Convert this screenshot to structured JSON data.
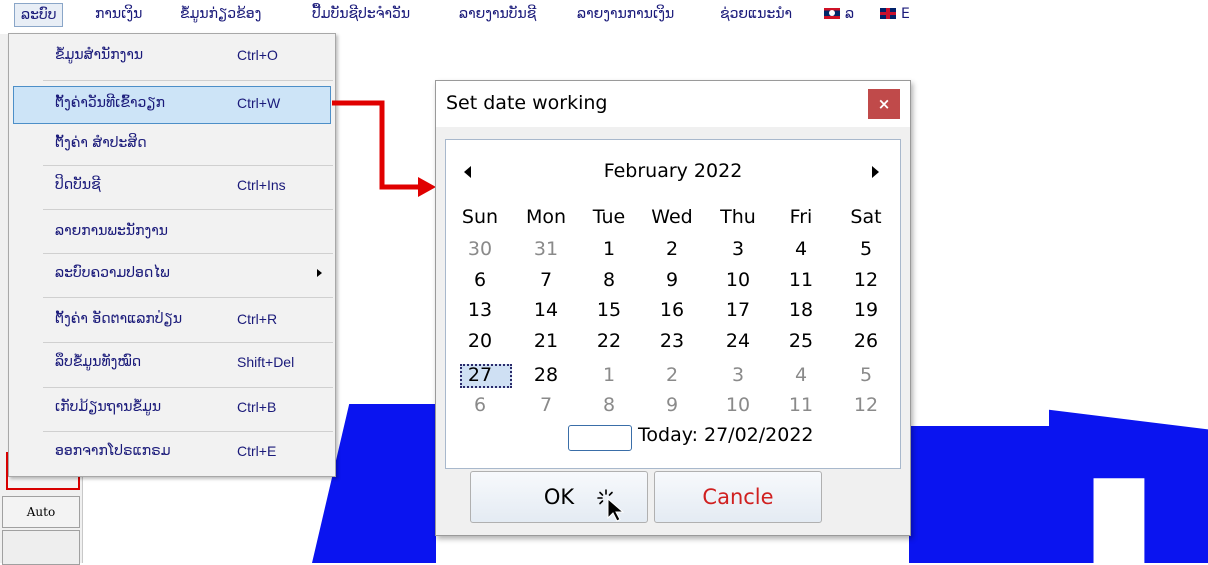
{
  "menubar": {
    "items": [
      {
        "label": "ລະບົບ"
      },
      {
        "label": "ການເງິນ"
      },
      {
        "label": "ຂໍ້ມູນກ່ຽວຂ້ອງ"
      },
      {
        "label": "ປື້ມບັນຊີປະຈຳວັນ"
      },
      {
        "label": "ລາຍງານບັນຊີ"
      },
      {
        "label": "ລາຍງານການເງິນ"
      },
      {
        "label": "ຊ່ວຍແນະນຳ"
      },
      {
        "label": "ລ"
      },
      {
        "label": "E"
      }
    ]
  },
  "dropdown": {
    "items": [
      {
        "label": "ຂໍ້ມູນສຳນັກງານ",
        "shortcut": "Ctrl+O"
      },
      {
        "label": "ຕັ້ງຄ່າວັນທີເຂົ້າວຽກ",
        "shortcut": "Ctrl+W"
      },
      {
        "label": "ຕັ້ງຄ່າ ສຳປະສິດ",
        "shortcut": ""
      },
      {
        "label": "ປິດບັນຊີ",
        "shortcut": "Ctrl+Ins"
      },
      {
        "label": "ລາຍການພະນັກງານ",
        "shortcut": ""
      },
      {
        "label": "ລະບົບຄວາມປອດໄພ",
        "shortcut": ""
      },
      {
        "label": "ຕັ້ງຄ່າ ອັດຕາແລກປ່ຽນ",
        "shortcut": "Ctrl+R"
      },
      {
        "label": "ລຶບຂໍ້ມູນທັງໝົດ",
        "shortcut": "Shift+Del"
      },
      {
        "label": "ເກັບມ້ຽນຖານຂໍ້ມູນ",
        "shortcut": "Ctrl+B"
      },
      {
        "label": "ອອກຈາກໂປຣແກຣມ",
        "shortcut": "Ctrl+E"
      }
    ]
  },
  "left_panel": {
    "auto_label": "Auto"
  },
  "dialog": {
    "title": "Set date working",
    "close_glyph": "×",
    "calendar": {
      "month": "February 2022",
      "weekdays": [
        "Sun",
        "Mon",
        "Tue",
        "Wed",
        "Thu",
        "Fri",
        "Sat"
      ],
      "weeks": [
        [
          "30",
          "31",
          "1",
          "2",
          "3",
          "4",
          "5"
        ],
        [
          "6",
          "7",
          "8",
          "9",
          "10",
          "11",
          "12"
        ],
        [
          "13",
          "14",
          "15",
          "16",
          "17",
          "18",
          "19"
        ],
        [
          "20",
          "21",
          "22",
          "23",
          "24",
          "25",
          "26"
        ],
        [
          "27",
          "28",
          "1",
          "2",
          "3",
          "4",
          "5"
        ],
        [
          "6",
          "7",
          "8",
          "9",
          "10",
          "11",
          "12"
        ]
      ],
      "today_text": "Today: 27/02/2022"
    },
    "ok_label": "OK",
    "cancel_label": "Cancle"
  },
  "colors": {
    "accent_blue": "#0a14f0",
    "annotation_red": "#e00000",
    "cancel_text": "#d02020",
    "menu_text": "#1a1a7a"
  }
}
